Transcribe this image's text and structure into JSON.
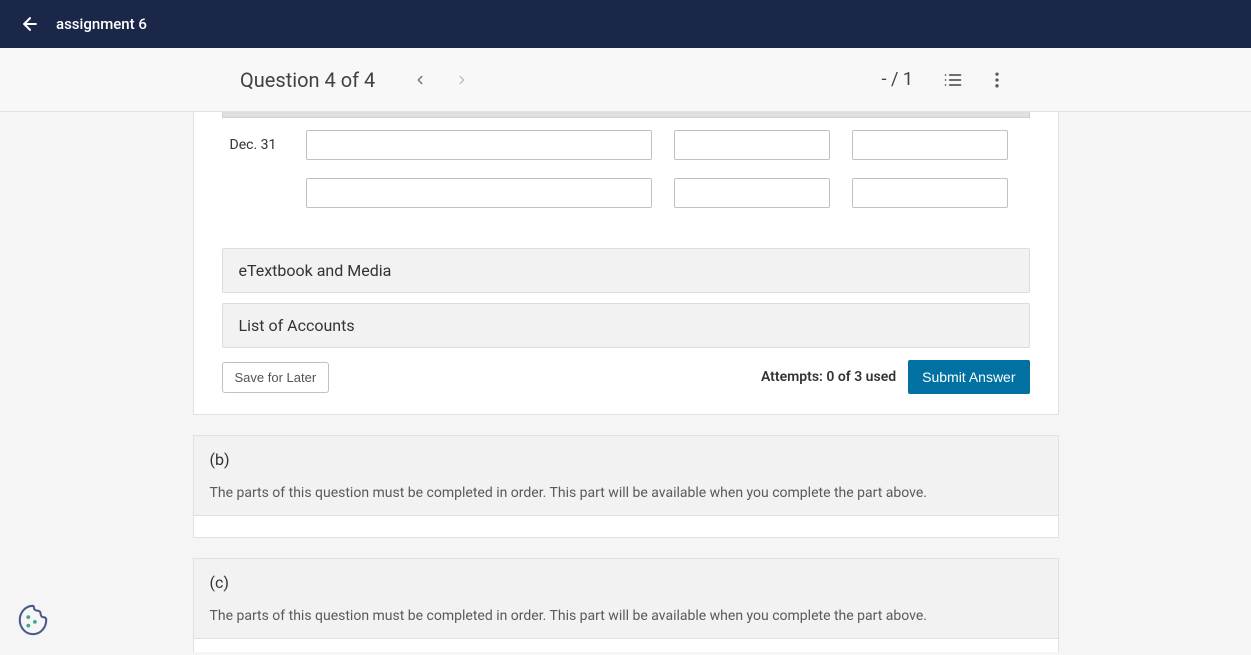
{
  "header": {
    "title": "assignment 6"
  },
  "subheader": {
    "question_label": "Question 4 of 4",
    "score": "- / 1"
  },
  "entry": {
    "date": "Dec. 31"
  },
  "accordions": {
    "etextbook": "eTextbook and Media",
    "accounts": "List of Accounts"
  },
  "actions": {
    "save": "Save for Later",
    "attempts": "Attempts: 0 of 3 used",
    "submit": "Submit Answer"
  },
  "parts": {
    "b": {
      "label": "(b)",
      "message": "The parts of this question must be completed in order. This part will be available when you complete the part above."
    },
    "c": {
      "label": "(c)",
      "message": "The parts of this question must be completed in order. This part will be available when you complete the part above."
    }
  }
}
